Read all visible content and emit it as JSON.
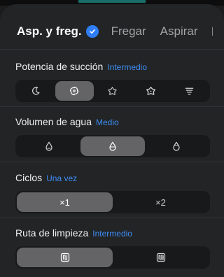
{
  "tabs": [
    {
      "label": "Asp. y freg."
    },
    {
      "label": "Fregar"
    },
    {
      "label": "Aspirar"
    }
  ],
  "suction": {
    "title": "Potencia de succión",
    "value": "Intermedio",
    "options": [
      "moon-icon",
      "swirl-icon",
      "fan-icon",
      "fan-strong-icon",
      "tornado-icon"
    ],
    "selected_index": 1
  },
  "water": {
    "title": "Volumen de agua",
    "value": "Medio",
    "options": [
      "water-drop-low-icon",
      "water-drop-medium-icon",
      "water-drop-high-icon"
    ],
    "selected_index": 1
  },
  "cycles": {
    "title": "Ciclos",
    "value": "Una vez",
    "options": [
      "×1",
      "×2"
    ],
    "selected_index": 0
  },
  "route": {
    "title": "Ruta de limpieza",
    "value": "Intermedio",
    "options": [
      "route-standard-icon",
      "route-deep-icon"
    ],
    "selected_index": 0
  },
  "colors": {
    "accent": "#3d8ef5",
    "selected_segment": "#646466",
    "background": "#232426"
  }
}
